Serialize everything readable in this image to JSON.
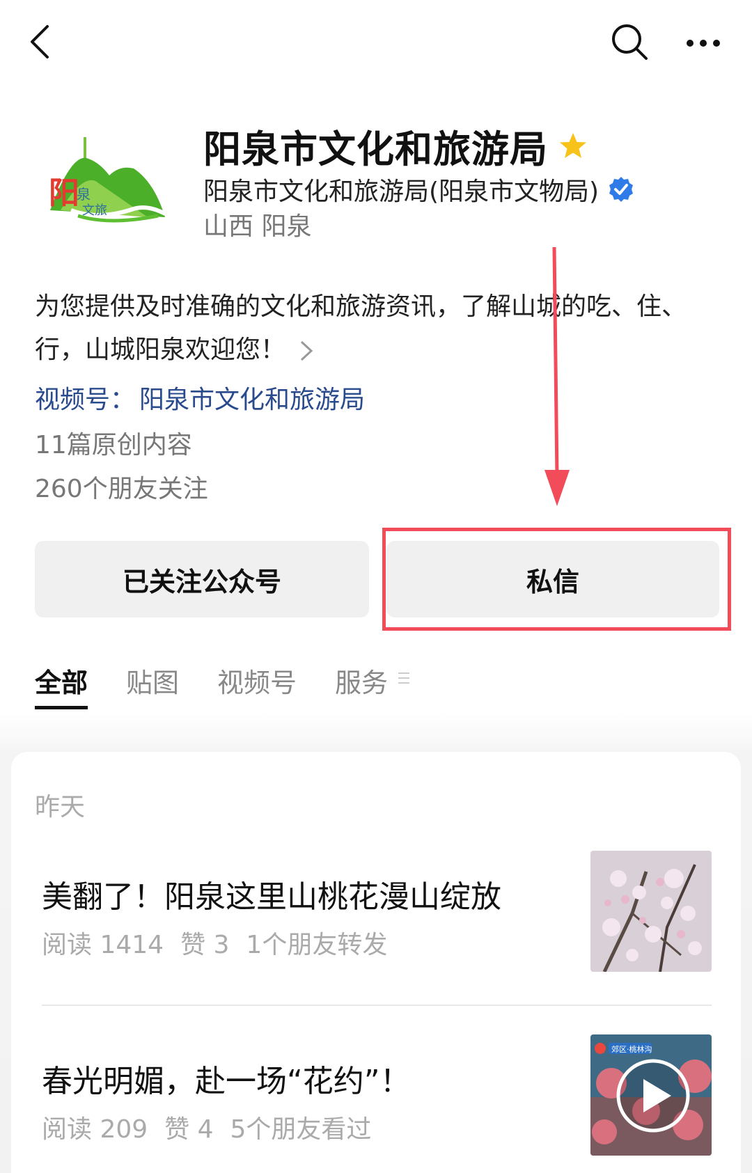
{
  "profile": {
    "name": "阳泉市文化和旅游局",
    "org": "阳泉市文化和旅游局(阳泉市文物局)",
    "region": "山西 阳泉",
    "logo_text": "阳泉文旅"
  },
  "description": "为您提供及时准确的文化和旅游资讯，了解山城的吃、住、行，山城阳泉欢迎您！",
  "channel": {
    "label": "视频号：",
    "value": "阳泉市文化和旅游局"
  },
  "stats": {
    "original": "11篇原创内容",
    "followers": "260个朋友关注"
  },
  "buttons": {
    "follow": "已关注公众号",
    "message": "私信"
  },
  "tabs": [
    "全部",
    "贴图",
    "视频号",
    "服务"
  ],
  "feed": {
    "date": "昨天",
    "articles": [
      {
        "title": "美翻了！阳泉这里山桃花漫山绽放",
        "reads": "阅读 1414",
        "likes": "赞 3",
        "social": "1个朋友转发"
      },
      {
        "title": "春光明媚，赴一场“花约”！",
        "reads": "阅读 209",
        "likes": "赞 4",
        "social": "5个朋友看过",
        "thumb_label": "郊区·桃林沟"
      }
    ]
  },
  "colors": {
    "accent_link": "#2a4a8e",
    "highlight": "#f24b5a",
    "star": "#f7c21a",
    "verified": "#2f7ce8"
  }
}
